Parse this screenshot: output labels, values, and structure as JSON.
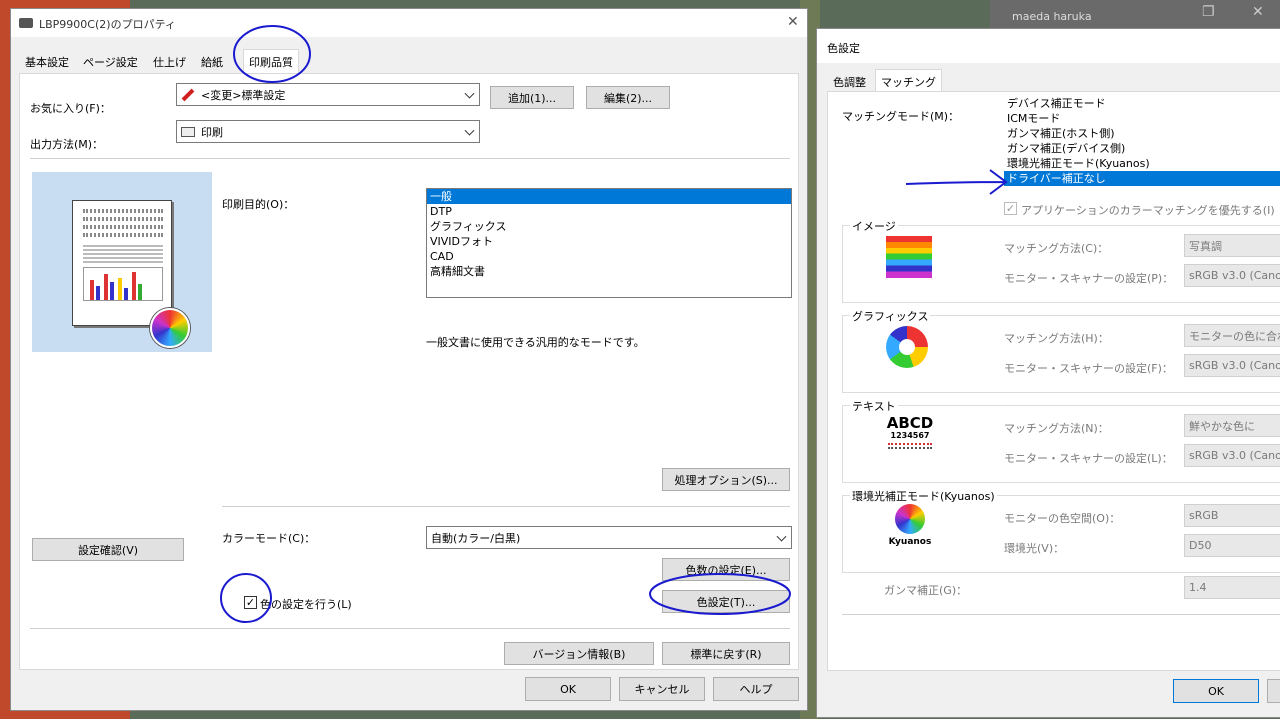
{
  "background": {
    "user_name": "maeda haruka"
  },
  "printer_dialog": {
    "title": "LBP9900C(2)のプロパティ",
    "tabs": [
      "基本設定",
      "ページ設定",
      "仕上げ",
      "給紙",
      "印刷品質"
    ],
    "active_tab": "印刷品質",
    "favorites_label": "お気に入り(F)：",
    "favorites_value": "<変更>標準設定",
    "add_button": "追加(1)...",
    "edit_button": "編集(2)...",
    "output_label": "出力方法(M)：",
    "output_value": "印刷",
    "purpose_label": "印刷目的(O)：",
    "purpose_items": [
      "一般",
      "DTP",
      "グラフィックス",
      "VIVIDフォト",
      "CAD",
      "高精細文書"
    ],
    "purpose_selected_index": 0,
    "purpose_description": "一般文書に使用できる汎用的なモードです。",
    "process_options_button": "処理オプション(S)...",
    "confirm_settings_button": "設定確認(V)",
    "color_mode_label": "カラーモード(C)：",
    "color_mode_value": "自動(カラー/白黒)",
    "color_count_button": "色数の設定(E)...",
    "color_setting_checkbox_label": "色の設定を行う(L)",
    "color_setting_checked": true,
    "color_setting_button": "色設定(T)...",
    "version_button": "バージョン情報(B)",
    "restore_button": "標準に戻す(R)",
    "ok_button": "OK",
    "cancel_button": "キャンセル",
    "help_button": "ヘルプ"
  },
  "color_dialog": {
    "title": "色設定",
    "tabs": [
      "色調整",
      "マッチング"
    ],
    "active_tab": "マッチング",
    "matching_mode_label": "マッチングモード(M)：",
    "matching_modes": [
      "デバイス補正モード",
      "ICMモード",
      "ガンマ補正(ホスト側)",
      "ガンマ補正(デバイス側)",
      "環境光補正モード(Kyuanos)",
      "ドライバー補正なし"
    ],
    "matching_mode_selected_index": 5,
    "app_priority_label": "アプリケーションのカラーマッチングを優先する(I)",
    "app_priority_checked": true,
    "image_group": {
      "title": "イメージ",
      "method_label": "マッチング方法(C)：",
      "method_value": "写真調",
      "monitor_label": "モニター・スキャナーの設定(P)：",
      "monitor_value": "sRGB v3.0 (Canon"
    },
    "graphics_group": {
      "title": "グラフィックス",
      "method_label": "マッチング方法(H)：",
      "method_value": "モニターの色に合わ",
      "monitor_label": "モニター・スキャナーの設定(F)：",
      "monitor_value": "sRGB v3.0 (Canon"
    },
    "text_group": {
      "title": "テキスト",
      "method_label": "マッチング方法(N)：",
      "method_value": "鮮やかな色に",
      "monitor_label": "モニター・スキャナーの設定(L)：",
      "monitor_value": "sRGB v3.0 (Canon",
      "icon_big": "ABCD",
      "icon_num": "1234567"
    },
    "kyuanos_group": {
      "title": "環境光補正モード(Kyuanos)",
      "space_label": "モニターの色空間(O)：",
      "space_value": "sRGB",
      "light_label": "環境光(V)：",
      "light_value": "D50",
      "logo_text": "Kyuanos"
    },
    "gamma_label": "ガンマ補正(G)：",
    "gamma_value": "1.4",
    "ok_button": "OK"
  },
  "colors": {
    "selection": "#0078d7",
    "annotation_ink": "#1a1acf"
  }
}
